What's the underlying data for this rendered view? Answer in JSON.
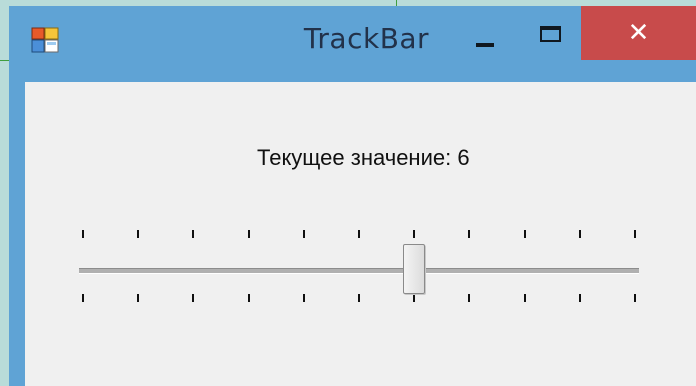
{
  "window": {
    "title": "TrackBar",
    "close_glyph": "✕",
    "icons": {
      "app": "app-window-icon",
      "minimize": "minimize-icon",
      "maximize": "maximize-icon",
      "close": "close-icon"
    }
  },
  "content": {
    "value_label": "Текущее значение: 6"
  },
  "trackbar": {
    "minimum": 0,
    "maximum": 10,
    "value": 6,
    "tick_frequency": 1
  },
  "colors": {
    "titlebar": "#5fa3d5",
    "close_button": "#c84b4b",
    "client_background": "#f0f0f0"
  }
}
